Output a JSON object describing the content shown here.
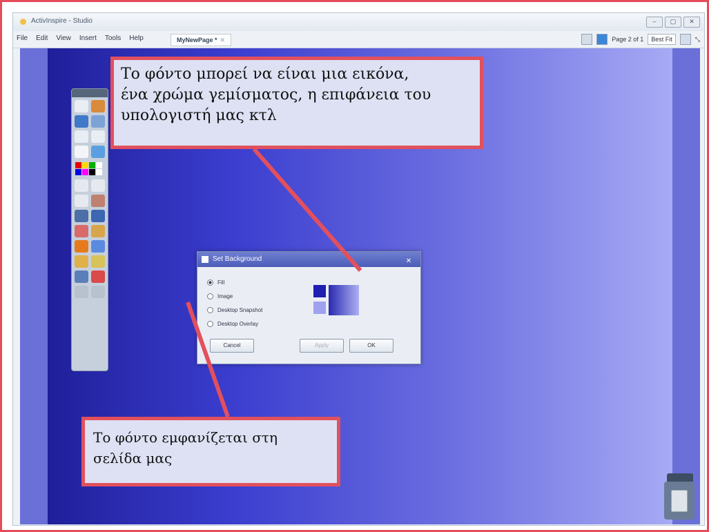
{
  "window": {
    "title": "ActivInspire - Studio",
    "controls": [
      "–",
      "▢",
      "✕"
    ]
  },
  "menubar": {
    "items": [
      "File",
      "Edit",
      "View",
      "Insert",
      "Tools",
      "Help"
    ],
    "tab_label": "MyNewPage *",
    "page_indicator": "Page 2 of 1",
    "zoom_select": "Best Fit"
  },
  "toolbox": {
    "colors": [
      "#e60000",
      "#ffd800",
      "#00b000",
      "#ffffff",
      "#0000e6",
      "#ff00ff",
      "#000000",
      "#ffffff"
    ]
  },
  "dialog": {
    "title": "Set Background",
    "options": [
      {
        "label": "Fill",
        "selected": true
      },
      {
        "label": "Image",
        "selected": false
      },
      {
        "label": "Desktop Snapshot",
        "selected": false
      },
      {
        "label": "Desktop Overlay",
        "selected": false
      }
    ],
    "buttons": {
      "cancel": "Cancel",
      "apply": "Apply",
      "ok": "OK"
    },
    "preview_colors": {
      "primary": "#1f1fb0",
      "secondary": "#9fa2ef"
    }
  },
  "callouts": {
    "top": {
      "line1": "Το φόντο μπορεί να είναι μια εικόνα,",
      "line2": "ένα χρώμα γεμίσματος, η επιφάνεια του",
      "line3": "υπολογιστή μας κτλ"
    },
    "bottom": {
      "line1": "Το φόντο εμφανίζεται στη",
      "line2": "σελίδα μας"
    },
    "accent": "#e2505d"
  }
}
